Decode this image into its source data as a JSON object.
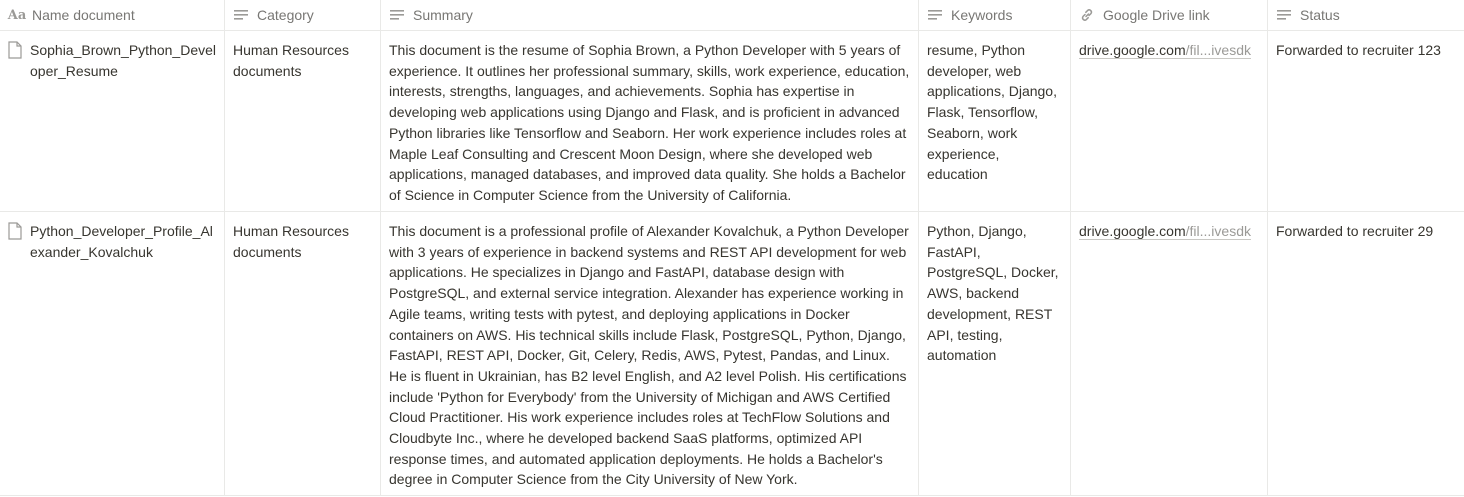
{
  "columns": [
    {
      "label": "Name document",
      "icon": "text-property-icon"
    },
    {
      "label": "Category",
      "icon": "lines-icon"
    },
    {
      "label": "Summary",
      "icon": "lines-icon"
    },
    {
      "label": "Keywords",
      "icon": "lines-icon"
    },
    {
      "label": "Google Drive link",
      "icon": "link-icon"
    },
    {
      "label": "Status",
      "icon": "lines-icon"
    }
  ],
  "rows": [
    {
      "name": "Sophia_Brown_Python_Developer_Resume",
      "category": "Human Resources documents",
      "summary": "This document is the resume of Sophia Brown, a Python Developer with 5 years of experience. It outlines her professional summary, skills, work experience, education, interests, strengths, languages, and achievements. Sophia has expertise in developing web applications using Django and Flask, and is proficient in advanced Python libraries like Tensorflow and Seaborn. Her work experience includes roles at Maple Leaf Consulting and Crescent Moon Design, where she developed web applications, managed databases, and improved data quality. She holds a Bachelor of Science in Computer Science from the University of California.",
      "keywords": "resume, Python developer, web applications, Django, Flask, Tensorflow, Seaborn, work experience, education",
      "link_main": "drive.google.com",
      "link_faded": "/fil...ivesdk",
      "status": "Forwarded to recruiter 123"
    },
    {
      "name": "Python_Developer_Profile_Alexander_Kovalchuk",
      "category": "Human Resources documents",
      "summary": "This document is a professional profile of Alexander Kovalchuk, a Python Developer with 3 years of experience in backend systems and REST API development for web applications. He specializes in Django and FastAPI, database design with PostgreSQL, and external service integration. Alexander has experience working in Agile teams, writing tests with pytest, and deploying applications in Docker containers on AWS. His technical skills include Flask, PostgreSQL, Python, Django, FastAPI, REST API, Docker, Git, Celery, Redis, AWS, Pytest, Pandas, and Linux. He is fluent in Ukrainian, has B2 level English, and A2 level Polish. His certifications include 'Python for Everybody' from the University of Michigan and AWS Certified Cloud Practitioner. His work experience includes roles at TechFlow Solutions and Cloudbyte Inc., where he developed backend SaaS platforms, optimized API response times, and automated application deployments. He holds a Bachelor's degree in Computer Science from the City University of New York.",
      "keywords": "Python, Django, FastAPI, PostgreSQL, Docker, AWS, backend development, REST API, testing, automation",
      "link_main": "drive.google.com",
      "link_faded": "/fil...ivesdk",
      "status": "Forwarded to recruiter 29"
    }
  ]
}
